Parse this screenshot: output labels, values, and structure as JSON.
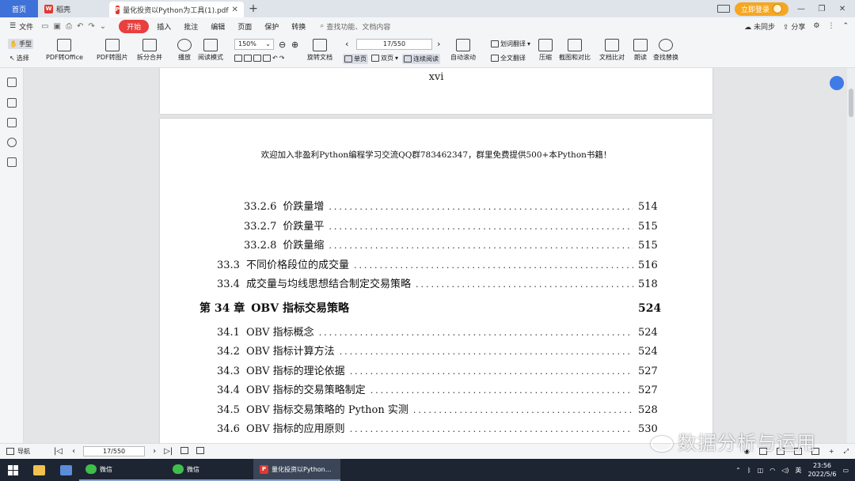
{
  "tabs": {
    "home": "首页",
    "draft": "稻壳",
    "document": "量化投资以Python为工具(1).pdf",
    "login": "立即登录"
  },
  "menu": {
    "file": "文件",
    "items": [
      "开始",
      "插入",
      "批注",
      "编辑",
      "页面",
      "保护",
      "转换"
    ],
    "search": "查找功能、文档内容",
    "right": [
      "未同步",
      "分享"
    ]
  },
  "toolbar": {
    "hand": "手型",
    "select": "选择",
    "pdf_to_office": "PDF转Office",
    "pdf_to_image": "PDF转图片",
    "split_merge": "拆分合并",
    "play": "播放",
    "read_mode": "阅读模式",
    "zoom": "150%",
    "page_input": "17/550",
    "rotate": "旋转文档",
    "single": "单页",
    "double": "双页",
    "continuous": "连续阅读",
    "auto_scroll": "自动滚动",
    "word_translate": "划词翻译",
    "full_translate": "全文翻译",
    "compress": "压缩",
    "screenshot_compare": "截图和对比",
    "doc_compare": "文档比对",
    "read_aloud": "朗读",
    "find_replace": "查找替换"
  },
  "document": {
    "prev_page_number": "xvi",
    "banner": "欢迎加入非盈利Python编程学习交流QQ群783462347，群里免费提供500+本Python书籍！",
    "toc": [
      {
        "num": "33.2.6",
        "title": "价跌量增",
        "page": "514",
        "level": 3
      },
      {
        "num": "33.2.7",
        "title": "价跌量平",
        "page": "515",
        "level": 3
      },
      {
        "num": "33.2.8",
        "title": "价跌量缩",
        "page": "515",
        "level": 3
      },
      {
        "num": "33.3",
        "title": "不同价格段位的成交量",
        "page": "516",
        "level": 2
      },
      {
        "num": "33.4",
        "title": "成交量与均线思想结合制定交易策略",
        "page": "518",
        "level": 2
      },
      {
        "num": "第 34 章",
        "title": "OBV 指标交易策略",
        "page": "524",
        "level": 1
      },
      {
        "num": "34.1",
        "title": "OBV 指标概念",
        "page": "524",
        "level": 2
      },
      {
        "num": "34.2",
        "title": "OBV 指标计算方法",
        "page": "524",
        "level": 2
      },
      {
        "num": "34.3",
        "title": "OBV 指标的理论依据",
        "page": "527",
        "level": 2
      },
      {
        "num": "34.4",
        "title": "OBV 指标的交易策略制定",
        "page": "527",
        "level": 2
      },
      {
        "num": "34.5",
        "title": "OBV 指标交易策略的 Python 实测",
        "page": "528",
        "level": 2
      },
      {
        "num": "34.6",
        "title": "OBV 指标的应用原则",
        "page": "530",
        "level": 2
      }
    ]
  },
  "statusbar": {
    "nav_label": "导航",
    "page": "17/550",
    "watermark": "数据分析与运用"
  },
  "taskbar": {
    "apps": [
      "微信",
      "微信",
      "量化投资以Python..."
    ],
    "time": "23:56",
    "date": "2022/5/6",
    "ime": "英"
  }
}
